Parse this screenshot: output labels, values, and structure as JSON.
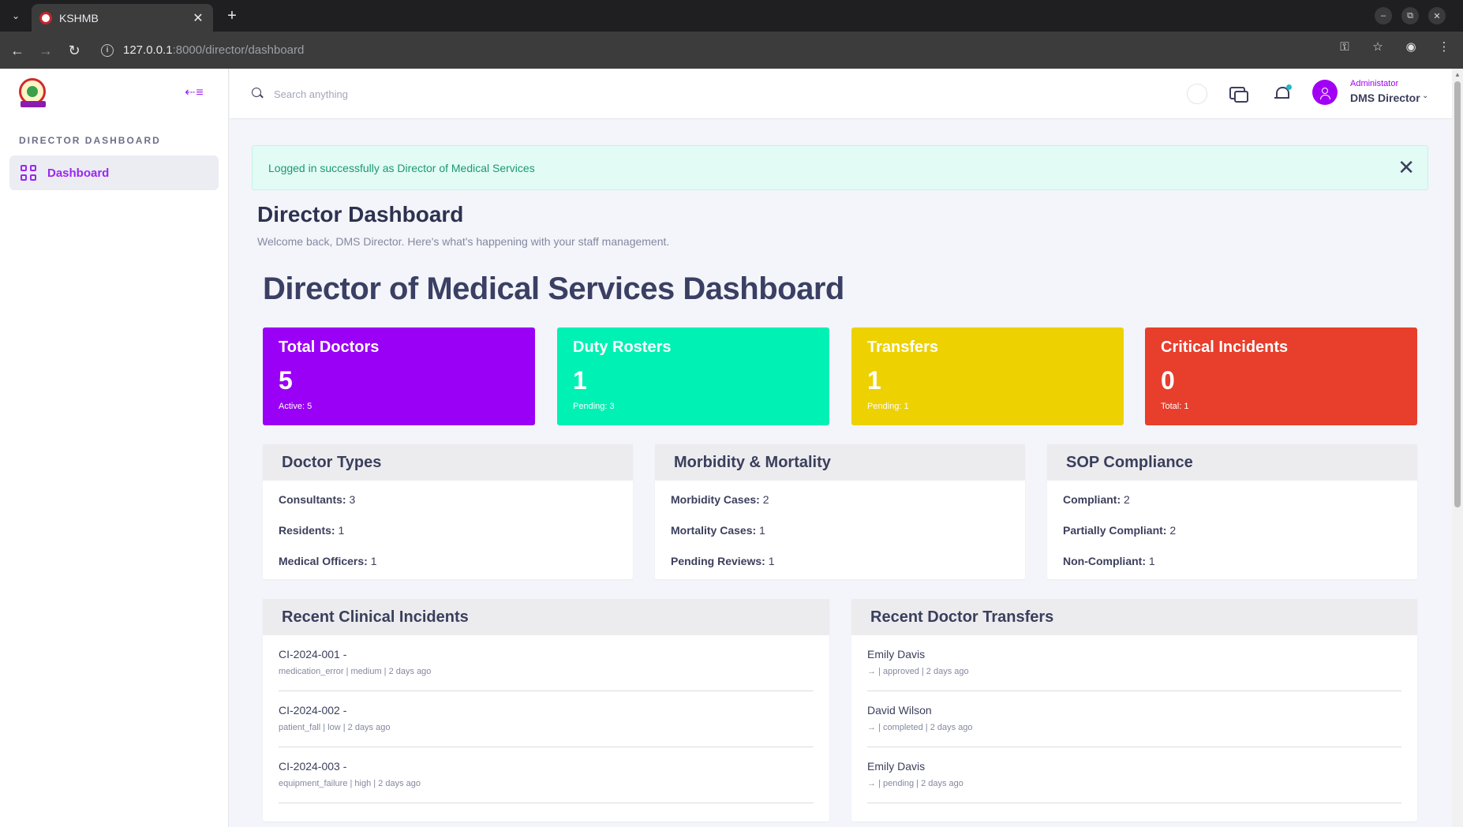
{
  "browser": {
    "tab_title": "KSHMB",
    "url_host": "127.0.0.1",
    "url_rest": ":8000/director/dashboard"
  },
  "sidebar": {
    "heading": "DIRECTOR DASHBOARD",
    "items": [
      {
        "label": "Dashboard",
        "icon": "grid-icon",
        "active": true
      }
    ]
  },
  "header": {
    "search_placeholder": "Search anything",
    "user_role": "Administator",
    "user_name": "DMS Director"
  },
  "alert": {
    "message": "Logged in successfully as Director of Medical Services"
  },
  "page": {
    "title": "Director Dashboard",
    "subtitle": "Welcome back, DMS Director. Here's what's happening with your staff management.",
    "dashboard_title": "Director of Medical Services Dashboard"
  },
  "stats": [
    {
      "title": "Total Doctors",
      "value": "5",
      "sub": "Active: 5",
      "color": "#9a00f6"
    },
    {
      "title": "Duty Rosters",
      "value": "1",
      "sub": "Pending: 3",
      "color": "#00f1b4"
    },
    {
      "title": "Transfers",
      "value": "1",
      "sub": "Pending: 1",
      "color": "#edd100"
    },
    {
      "title": "Critical Incidents",
      "value": "0",
      "sub": "Total: 1",
      "color": "#e83e2c"
    }
  ],
  "panels": {
    "doctor_types": {
      "title": "Doctor Types",
      "rows": [
        {
          "label": "Consultants:",
          "value": " 3"
        },
        {
          "label": "Residents:",
          "value": " 1"
        },
        {
          "label": "Medical Officers:",
          "value": " 1"
        }
      ]
    },
    "morbidity": {
      "title": "Morbidity & Mortality",
      "rows": [
        {
          "label": "Morbidity Cases:",
          "value": " 2"
        },
        {
          "label": "Mortality Cases:",
          "value": " 1"
        },
        {
          "label": "Pending Reviews:",
          "value": " 1"
        }
      ]
    },
    "sop": {
      "title": "SOP Compliance",
      "rows": [
        {
          "label": "Compliant:",
          "value": " 2"
        },
        {
          "label": "Partially Compliant:",
          "value": " 2"
        },
        {
          "label": "Non-Compliant:",
          "value": " 1"
        }
      ]
    },
    "incidents": {
      "title": "Recent Clinical Incidents",
      "items": [
        {
          "title": "CI-2024-001 -",
          "sub": "medication_error | medium | 2 days ago"
        },
        {
          "title": "CI-2024-002 -",
          "sub": "patient_fall | low | 2 days ago"
        },
        {
          "title": "CI-2024-003 -",
          "sub": "equipment_failure | high | 2 days ago"
        }
      ]
    },
    "transfers": {
      "title": "Recent Doctor Transfers",
      "items": [
        {
          "title": "Emily Davis",
          "sub": "→ | approved | 2 days ago"
        },
        {
          "title": "David Wilson",
          "sub": "→ | completed | 2 days ago"
        },
        {
          "title": "Emily Davis",
          "sub": "→ | pending | 2 days ago"
        }
      ]
    }
  }
}
